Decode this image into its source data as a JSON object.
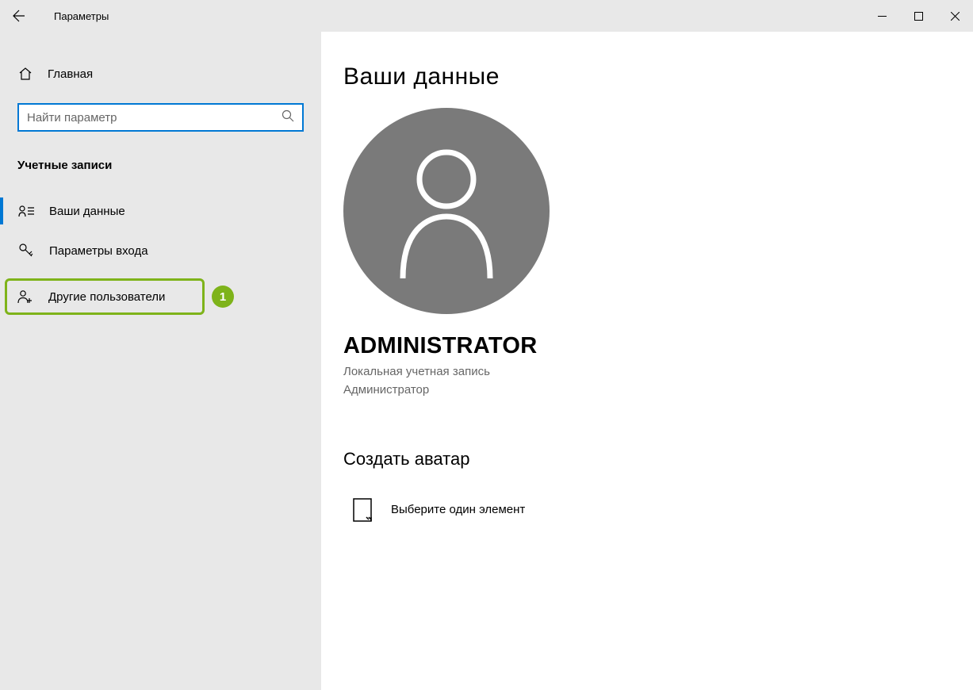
{
  "window": {
    "title": "Параметры"
  },
  "sidebar": {
    "home": "Главная",
    "search_placeholder": "Найти параметр",
    "section_header": "Учетные записи",
    "items": [
      {
        "label": "Ваши данные"
      },
      {
        "label": "Параметры входа"
      },
      {
        "label": "Другие пользователи"
      }
    ]
  },
  "callout": {
    "number": "1"
  },
  "main": {
    "page_title": "Ваши данные",
    "username": "ADMINISTRATOR",
    "account_type": "Локальная учетная запись",
    "account_role": "Администратор",
    "create_avatar_header": "Создать аватар",
    "browse_label": "Выберите один элемент"
  }
}
